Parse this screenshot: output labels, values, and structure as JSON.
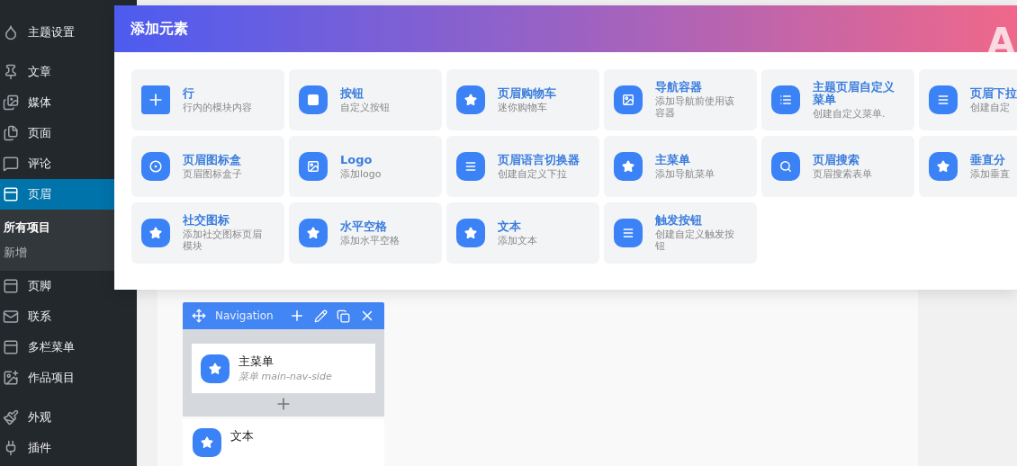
{
  "sidebar": {
    "items": [
      {
        "label": "主题设置",
        "selected": false
      },
      {
        "label": "文章",
        "selected": false
      },
      {
        "label": "媒体",
        "selected": false
      },
      {
        "label": "页面",
        "selected": false
      },
      {
        "label": "评论",
        "selected": false
      },
      {
        "label": "页眉",
        "selected": true,
        "children": [
          {
            "label": "所有项目",
            "selected": true
          },
          {
            "label": "新增",
            "selected": false
          }
        ]
      },
      {
        "label": "页脚",
        "selected": false
      },
      {
        "label": "联系",
        "selected": false
      },
      {
        "label": "多栏菜单",
        "selected": false
      },
      {
        "label": "作品项目",
        "selected": false
      },
      {
        "label": "外观",
        "selected": false
      },
      {
        "label": "插件",
        "selected": false
      }
    ]
  },
  "modal": {
    "title": "添加元素",
    "corner_text": "A",
    "elements": [
      {
        "title": "行",
        "description": "行内的模块内容",
        "kind": "plus"
      },
      {
        "title": "按钮",
        "description": "自定义按钮",
        "kind": "square"
      },
      {
        "title": "页眉购物车",
        "description": "迷你购物车",
        "kind": "star"
      },
      {
        "title": "导航容器",
        "description": "添加导航前使用该容器",
        "kind": "image"
      },
      {
        "title": "主题页眉自定义菜单",
        "description": "创建自定义菜单.",
        "kind": "list"
      },
      {
        "title": "页眉下拉",
        "description": "创建自定",
        "kind": "menu"
      },
      {
        "title": "页眉图标盒",
        "description": "页眉图标盒子",
        "kind": "target"
      },
      {
        "title": "Logo",
        "description": "添加logo",
        "kind": "image"
      },
      {
        "title": "页眉语言切换器",
        "description": "创建自定义下拉",
        "kind": "menu"
      },
      {
        "title": "主菜单",
        "description": "添加导航菜单",
        "kind": "star"
      },
      {
        "title": "页眉搜索",
        "description": "页眉搜索表单",
        "kind": "search"
      },
      {
        "title": "垂直分",
        "description": "添加垂直",
        "kind": "star"
      },
      {
        "title": "社交图标",
        "description": "添加社交图标页眉模块",
        "kind": "star"
      },
      {
        "title": "水平空格",
        "description": "添加水平空格",
        "kind": "star"
      },
      {
        "title": "文本",
        "description": "添加文本",
        "kind": "star"
      },
      {
        "title": "触发按钮",
        "description": "创建自定义触发按钮",
        "kind": "menu"
      }
    ]
  },
  "builder": {
    "container": {
      "title": "Navigation",
      "items": [
        {
          "title": "主菜单",
          "subtitle": "菜单 main-nav-side"
        }
      ]
    },
    "next_item": {
      "title": "文本"
    }
  }
}
